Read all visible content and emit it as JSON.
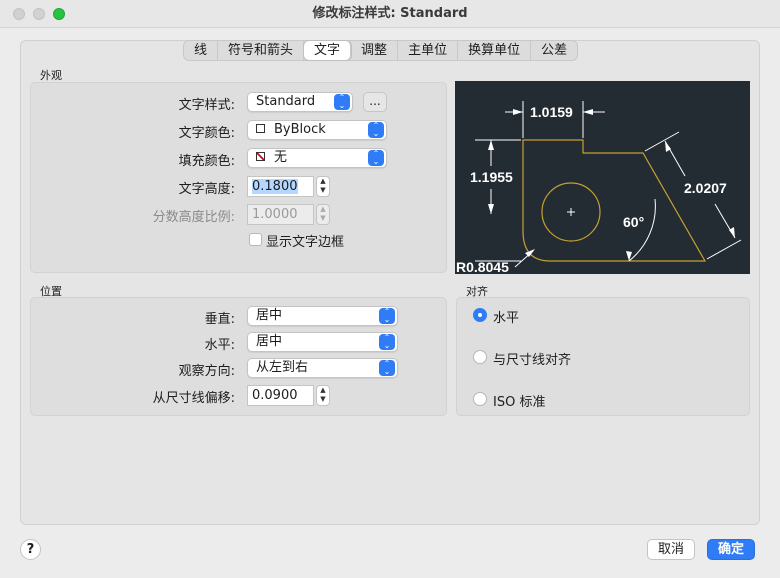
{
  "window": {
    "title": "修改标注样式: Standard"
  },
  "tabs": [
    "线",
    "符号和箭头",
    "文字",
    "调整",
    "主单位",
    "换算单位",
    "公差"
  ],
  "active_tab": "文字",
  "appearance": {
    "section": "外观",
    "text_style_label": "文字样式:",
    "text_style_value": "Standard",
    "ellipsis": "...",
    "text_color_label": "文字颜色:",
    "text_color_value": "ByBlock",
    "fill_color_label": "填充颜色:",
    "fill_color_value": "无",
    "text_height_label": "文字高度:",
    "text_height_value": "0.1800",
    "fraction_label": "分数高度比例:",
    "fraction_value": "1.0000",
    "frame_label": "显示文字边框"
  },
  "placement": {
    "section": "位置",
    "vertical_label": "垂直:",
    "vertical_value": "居中",
    "horizontal_label": "水平:",
    "horizontal_value": "居中",
    "view_label": "观察方向:",
    "view_value": "从左到右",
    "offset_label": "从尺寸线偏移:",
    "offset_value": "0.0900"
  },
  "alignment": {
    "section": "对齐",
    "options": [
      "水平",
      "与尺寸线对齐",
      "ISO 标准"
    ],
    "selected": "水平"
  },
  "preview": {
    "dim_top": "1.0159",
    "dim_left": "1.1955",
    "dim_right": "2.0207",
    "angle": "60°",
    "radius": "R0.8045"
  },
  "buttons": {
    "help": "?",
    "cancel": "取消",
    "ok": "确定"
  },
  "colors": {
    "accent": "#2f7cf6",
    "preview_bg": "#232b33",
    "preview_lines": "#c8a032"
  }
}
